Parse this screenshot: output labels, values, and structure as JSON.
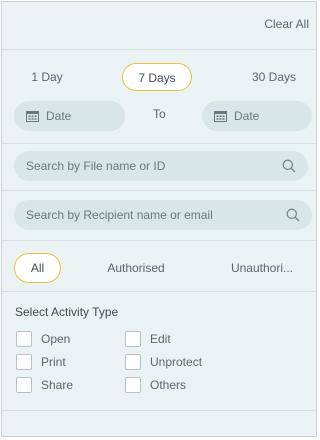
{
  "header": {
    "clear_all": "Clear All"
  },
  "periods": [
    {
      "label": "1 Day",
      "active": false
    },
    {
      "label": "7 Days",
      "active": true
    },
    {
      "label": "30 Days",
      "active": false
    }
  ],
  "date_range": {
    "from_placeholder": "Date",
    "to_label": "To",
    "to_placeholder": "Date"
  },
  "search": {
    "file_placeholder": "Search by File name or ID",
    "recipient_placeholder": "Search by Recipient name or email"
  },
  "authorisation": [
    {
      "label": "All",
      "active": true
    },
    {
      "label": "Authorised",
      "active": false
    },
    {
      "label": "Unauthori...",
      "active": false
    }
  ],
  "activity": {
    "title": "Select Activity Type",
    "options": [
      {
        "label": "Open",
        "checked": false
      },
      {
        "label": "Edit",
        "checked": false
      },
      {
        "label": "Print",
        "checked": false
      },
      {
        "label": "Unprotect",
        "checked": false
      },
      {
        "label": "Share",
        "checked": false
      },
      {
        "label": "Others",
        "checked": false
      }
    ]
  },
  "colors": {
    "accent_border": "#e6c23f",
    "panel_bg": "#ebf2f3",
    "field_bg": "#d9e6e7"
  },
  "icons": {
    "date": "calendar-icon",
    "search": "search-icon"
  }
}
